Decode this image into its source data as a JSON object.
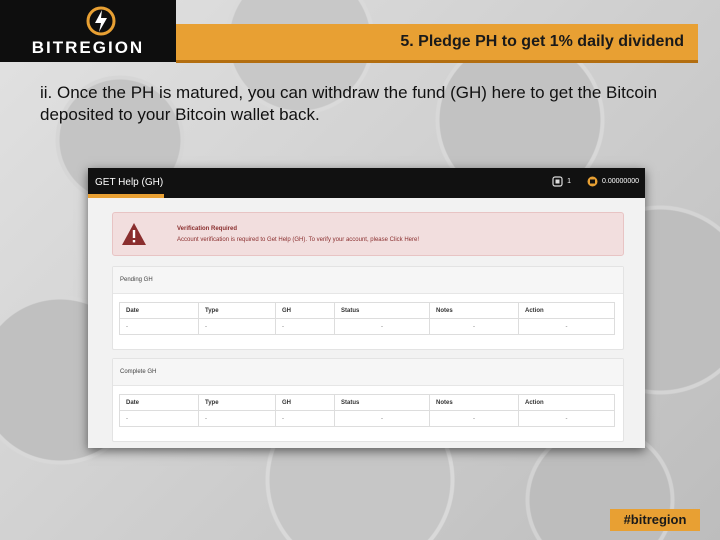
{
  "header": {
    "logo_text": "BITREGION",
    "title": "5. Pledge PH to get 1% daily dividend"
  },
  "intro": "ii. Once the PH is matured, you can withdraw the fund (GH) here to get the Bitcoin deposited to your Bitcoin wallet back.",
  "panel": {
    "title": "GET Help (GH)",
    "notification_count": "1",
    "balance": "0.00000000",
    "alert": {
      "title": "Verification Required",
      "message": "Account verification is required to Get Help (GH). To verify your account, please Click Here!"
    },
    "columns": [
      "Date",
      "Type",
      "GH",
      "Status",
      "Notes",
      "Action"
    ],
    "pending": {
      "title": "Pending GH",
      "row": [
        "-",
        "-",
        "-",
        "-",
        "-",
        "-"
      ]
    },
    "complete": {
      "title": "Complete GH",
      "row": [
        "-",
        "-",
        "-",
        "-",
        "-",
        "-"
      ]
    }
  },
  "hashtag": "#bitregion",
  "colors": {
    "accent": "#e8a033",
    "dark": "#0e0e0e",
    "alert_bg": "#f2dede",
    "alert_text": "#8a2e2e"
  }
}
